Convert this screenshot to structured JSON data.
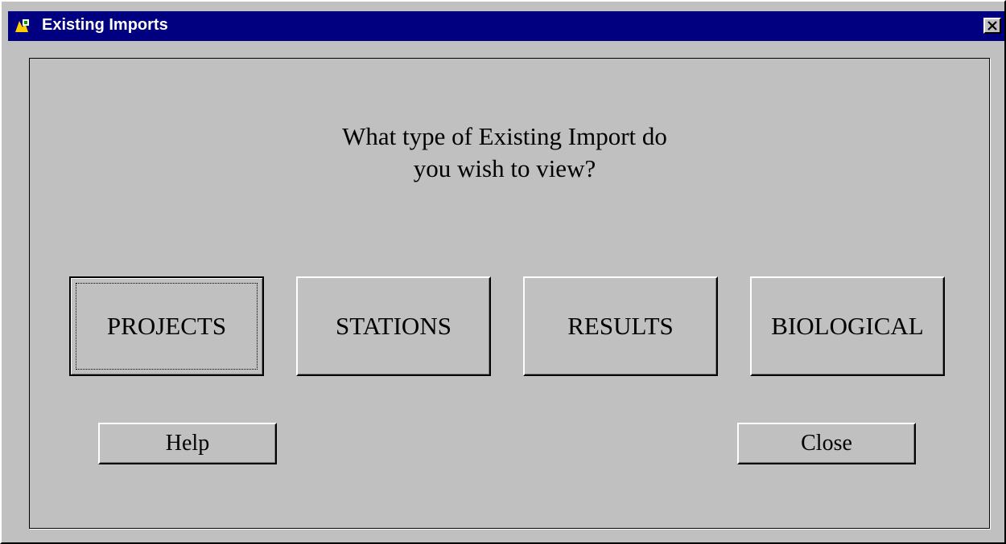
{
  "window": {
    "title": "Existing Imports",
    "app_icon": "app-icon",
    "close_icon": "close-icon"
  },
  "prompt": {
    "line1": "What type of Existing Import do",
    "line2": "you wish to view?"
  },
  "buttons": {
    "projects": "PROJECTS",
    "stations": "STATIONS",
    "results": "RESULTS",
    "biological": "BIOLOGICAL",
    "help": "Help",
    "close": "Close"
  },
  "colors": {
    "titlebar": "#000080",
    "face": "#c0c0c0"
  }
}
